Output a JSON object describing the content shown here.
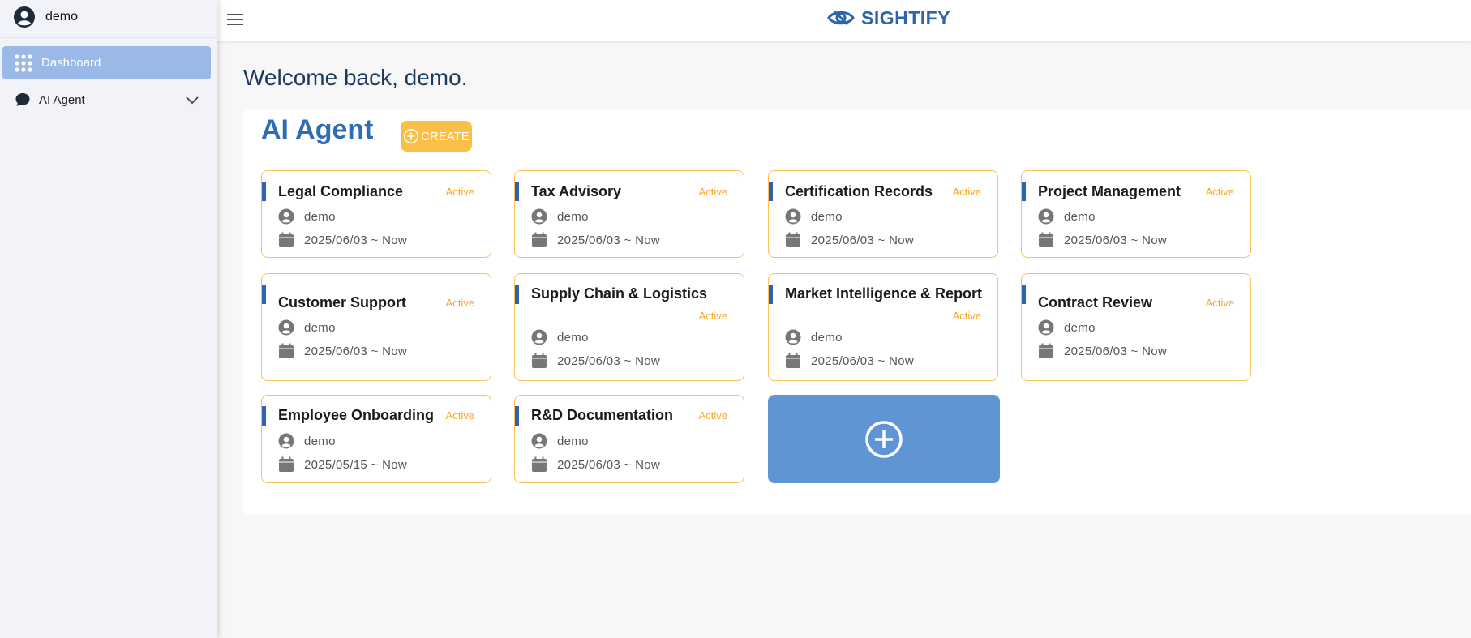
{
  "sidebar": {
    "user": "demo",
    "items": [
      {
        "label": "Dashboard",
        "icon": "grid-icon",
        "active": true
      },
      {
        "label": "AI Agent",
        "icon": "chat-icon",
        "expandable": true
      }
    ]
  },
  "topbar": {
    "brand": "SIGHTIFY",
    "menu_icon": "hamburger-icon"
  },
  "main": {
    "welcome": "Welcome back, demo.",
    "section_title": "AI Agent",
    "create_label": "CREATE",
    "cards": [
      {
        "title": "Legal Compliance",
        "status": "Active",
        "owner": "demo",
        "period": "2025/06/03 ~ Now"
      },
      {
        "title": "Tax Advisory",
        "status": "Active",
        "owner": "demo",
        "period": "2025/06/03 ~ Now"
      },
      {
        "title": "Certification Records",
        "status": "Active",
        "owner": "demo",
        "period": "2025/06/03 ~ Now"
      },
      {
        "title": "Project Management",
        "status": "Active",
        "owner": "demo",
        "period": "2025/06/03 ~ Now"
      },
      {
        "title": "Customer Support",
        "status": "Active",
        "owner": "demo",
        "period": "2025/06/03 ~ Now"
      },
      {
        "title": "Supply Chain & Logistics",
        "status": "Active",
        "owner": "demo",
        "period": "2025/06/03 ~ Now"
      },
      {
        "title": "Market Intelligence & Report",
        "status": "Active",
        "owner": "demo",
        "period": "2025/06/03 ~ Now"
      },
      {
        "title": "Contract Review",
        "status": "Active",
        "owner": "demo",
        "period": "2025/06/03 ~ Now"
      },
      {
        "title": "Employee Onboarding",
        "status": "Active",
        "owner": "demo",
        "period": "2025/05/15 ~ Now"
      },
      {
        "title": "R&D Documentation",
        "status": "Active",
        "owner": "demo",
        "period": "2025/06/03 ~ Now"
      }
    ]
  },
  "colors": {
    "accent": "#2d64ad",
    "card_border": "#f8c15a",
    "status": "#f5a623",
    "create_button": "#fbbf47",
    "add_card": "#5f95d4",
    "sidebar_active": "#9ab9e7"
  }
}
